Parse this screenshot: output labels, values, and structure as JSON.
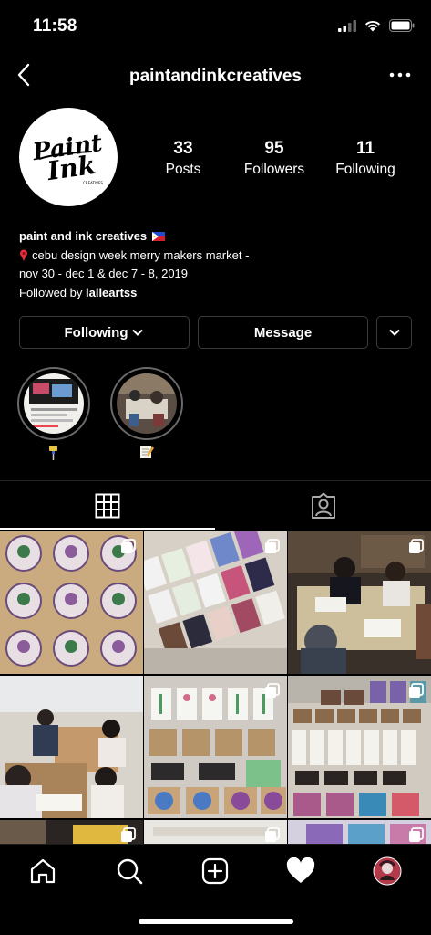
{
  "status": {
    "time": "11:58"
  },
  "header": {
    "username": "paintandinkcreatives"
  },
  "profile": {
    "logo_text": "Paint Ink",
    "stats": [
      {
        "value": "33",
        "label": "Posts"
      },
      {
        "value": "95",
        "label": "Followers"
      },
      {
        "value": "11",
        "label": "Following"
      }
    ],
    "bio": {
      "name": "paint and ink creatives",
      "line1": "cebu design week merry makers market -",
      "line2": "nov 30 - dec 1 & dec 7 - 8, 2019",
      "followed_prefix": "Followed by ",
      "followed_user": "lalleartss"
    }
  },
  "buttons": {
    "following": "Following",
    "message": "Message"
  },
  "highlights": [
    {
      "icon": "pushpin-emoji-icon"
    },
    {
      "icon": "memo-emoji-icon"
    }
  ],
  "tabs": [
    {
      "icon": "grid-icon",
      "active": true
    },
    {
      "icon": "tagged-icon",
      "active": false
    }
  ],
  "colors": {
    "background": "#000000",
    "border": "#3a3a3a",
    "text": "#ffffff"
  },
  "bottom_nav": [
    "home-icon",
    "search-icon",
    "new-post-icon",
    "activity-heart-icon",
    "profile-avatar"
  ]
}
